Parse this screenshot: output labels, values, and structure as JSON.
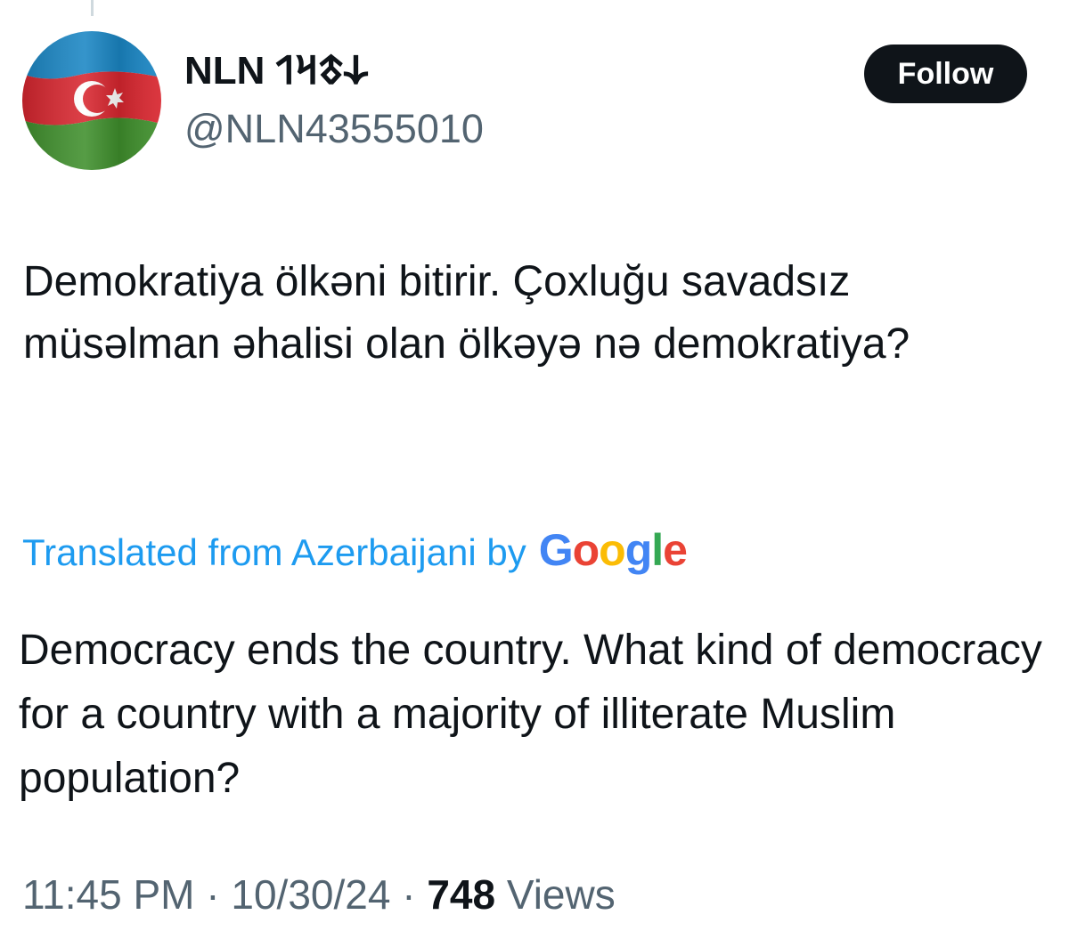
{
  "author": {
    "display_name": "NLN 𐰸𐱃𐰺𐰯",
    "handle": "@NLN43555010",
    "avatar_icon": "azerbaijan-flag-avatar"
  },
  "follow_button": {
    "label": "Follow"
  },
  "tweet": {
    "text": "Demokratiya ölkəni bitirir. Çoxluğu savadsız müsəlman əhalisi olan ölkəyə nə demokratiya?"
  },
  "translation": {
    "label": "Translated from Azerbaijani by",
    "provider": {
      "letters": [
        "G",
        "o",
        "o",
        "g",
        "l",
        "e"
      ],
      "colors": [
        "#4285F4",
        "#EA4335",
        "#FBBC05",
        "#4285F4",
        "#34A853",
        "#EA4335"
      ]
    },
    "text": "Democracy ends the country. What kind of democracy for a country with a majority of illiterate Muslim population?"
  },
  "meta": {
    "time": "11:45 PM",
    "date": "10/30/24",
    "separator": "·",
    "views_count": "748",
    "views_label": "Views"
  },
  "colors": {
    "link_blue": "#1d9bf0",
    "muted_gray": "#536471",
    "text_dark": "#0f1419",
    "flag_blue": "#00B5E2",
    "flag_red": "#EF3340",
    "flag_green": "#509E2F"
  }
}
